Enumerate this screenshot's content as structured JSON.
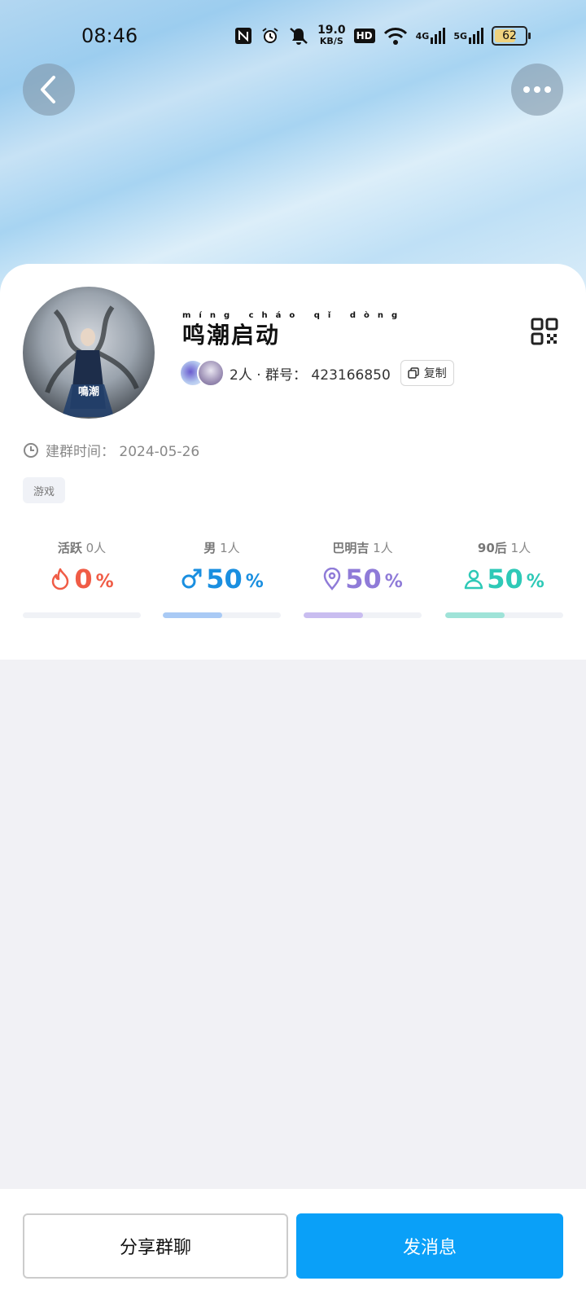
{
  "status_bar": {
    "time": "08:46",
    "net_speed_value": "19.0",
    "net_speed_unit": "KB/S",
    "hd": "HD",
    "sig1": "4G",
    "sig2": "5G",
    "battery": "62"
  },
  "group": {
    "name": "鸣潮启动",
    "pinyin": "míng cháo qǐ dòng",
    "avatar_text": "鳴潮",
    "member_info": "2人 · 群号： 423166850",
    "copy_label": "复制",
    "created": "建群时间： 2024-05-26",
    "tag": "游戏"
  },
  "stats": [
    {
      "label": "活跃",
      "count": "0人",
      "value": "0",
      "pct": "%",
      "color": "#f05c46",
      "bar_color": "#f7c9bf",
      "fraction": 0.0,
      "icon": "flame-icon"
    },
    {
      "label": "男",
      "count": "1人",
      "value": "50",
      "pct": "%",
      "color": "#1a8fe0",
      "bar_color": "#a9caf5",
      "fraction": 0.5,
      "icon": "male-icon"
    },
    {
      "label": "巴明吉",
      "count": "1人",
      "value": "50",
      "pct": "%",
      "color": "#8f7bd8",
      "bar_color": "#c9bdf0",
      "fraction": 0.5,
      "icon": "location-icon"
    },
    {
      "label": "90后",
      "count": "1人",
      "value": "50",
      "pct": "%",
      "color": "#2ec9b7",
      "bar_color": "#9fe3d8",
      "fraction": 0.5,
      "icon": "person-icon"
    }
  ],
  "bottom": {
    "share_label": "分享群聊",
    "send_label": "发消息"
  }
}
